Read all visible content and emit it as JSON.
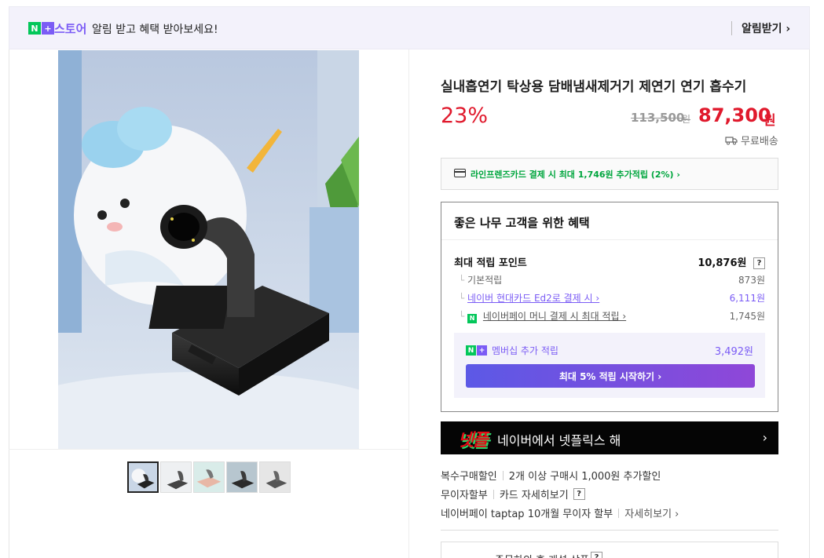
{
  "banner": {
    "logo_n": "N",
    "logo_plus": "+",
    "store_word": "스토어",
    "message": "알림 받고 혜택 받아보세요!",
    "button_label": "알림받기 ›"
  },
  "gallery": {
    "thumbnail_count": 5,
    "selected_index": 0
  },
  "product": {
    "title": "실내흡연기 탁상용 담배냄새제거기 제연기 연기 흡수기",
    "discount": "23%",
    "original_price": "113,500",
    "original_unit": "원",
    "sale_price": "87,300",
    "sale_unit": "원",
    "shipping": "무료배송"
  },
  "card_promo": {
    "text": "라인프렌즈카드 결제 시 최대 1,746원 추가적립 (2%) ›"
  },
  "benefits": {
    "title": "좋은 나무 고객을 위한 혜택",
    "max_points_label": "최대 적립 포인트",
    "max_points_value": "10,876원",
    "help": "?",
    "rows": [
      {
        "label": "기본적립",
        "value": "873원"
      },
      {
        "label": "네이버 현대카드 Ed2로 결제 시 ›",
        "value": "6,111원"
      },
      {
        "label": "네이버페이 머니 결제 시 최대 적립 ›",
        "value": "1,745원"
      }
    ],
    "member_label": "멤버십 추가 적립",
    "member_value": "3,492원",
    "member_button": "최대 5% 적립 시작하기 ›"
  },
  "netflix_banner": {
    "logo": "넷플",
    "text": "네이버에서 넷플릭스 해",
    "arrow": "›"
  },
  "purchase_info": {
    "multi_label": "복수구매할인",
    "multi_text": "2개 이상 구매시 1,000원 추가할인",
    "installment_label": "무이자할부",
    "installment_link": "카드 자세히보기",
    "help": "?",
    "taptap_text": "네이버페이 taptap 10개월 무이자 할부",
    "taptap_link": "자세히보기 ›"
  },
  "bottom_section": {
    "text": "주문하의 후 개설 상품",
    "help": "?"
  },
  "colors": {
    "brand_green": "#03c75a",
    "brand_purple": "#7b5cf5",
    "price_red": "#e0192c",
    "promo_green": "#00a63e"
  }
}
